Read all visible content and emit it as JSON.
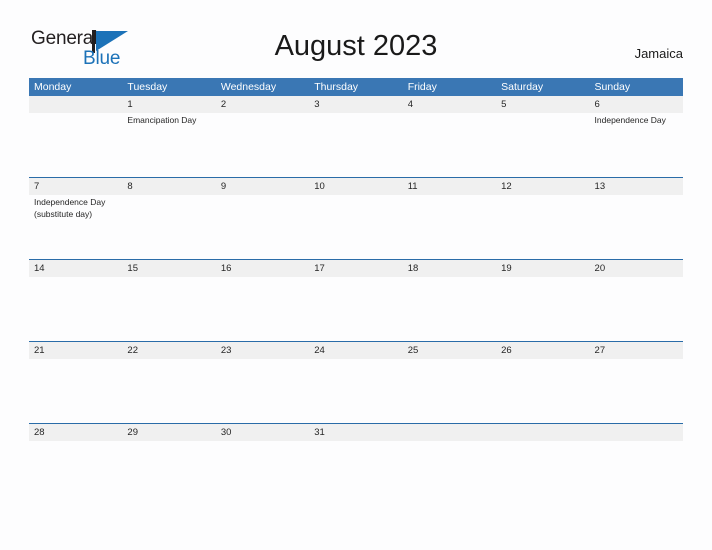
{
  "brand": {
    "name_part1": "General",
    "name_part2": "Blue",
    "flag_color": "#1c72b8",
    "icon": "flag-triangle-icon"
  },
  "header": {
    "title": "August 2023",
    "country": "Jamaica"
  },
  "colors": {
    "header_blue": "#3a77b4",
    "row_rule_blue": "#2a6ca8",
    "band_gray": "#f0f0f0",
    "page_background": "#fdfdfe",
    "text": "#262626"
  },
  "calendar": {
    "weekdays": [
      "Monday",
      "Tuesday",
      "Wednesday",
      "Thursday",
      "Friday",
      "Saturday",
      "Sunday"
    ],
    "weeks": [
      [
        {
          "date": "",
          "events": []
        },
        {
          "date": "1",
          "events": [
            "Emancipation Day"
          ]
        },
        {
          "date": "2",
          "events": []
        },
        {
          "date": "3",
          "events": []
        },
        {
          "date": "4",
          "events": []
        },
        {
          "date": "5",
          "events": []
        },
        {
          "date": "6",
          "events": [
            "Independence Day"
          ]
        }
      ],
      [
        {
          "date": "7",
          "events": [
            "Independence Day",
            "(substitute day)"
          ]
        },
        {
          "date": "8",
          "events": []
        },
        {
          "date": "9",
          "events": []
        },
        {
          "date": "10",
          "events": []
        },
        {
          "date": "11",
          "events": []
        },
        {
          "date": "12",
          "events": []
        },
        {
          "date": "13",
          "events": []
        }
      ],
      [
        {
          "date": "14",
          "events": []
        },
        {
          "date": "15",
          "events": []
        },
        {
          "date": "16",
          "events": []
        },
        {
          "date": "17",
          "events": []
        },
        {
          "date": "18",
          "events": []
        },
        {
          "date": "19",
          "events": []
        },
        {
          "date": "20",
          "events": []
        }
      ],
      [
        {
          "date": "21",
          "events": []
        },
        {
          "date": "22",
          "events": []
        },
        {
          "date": "23",
          "events": []
        },
        {
          "date": "24",
          "events": []
        },
        {
          "date": "25",
          "events": []
        },
        {
          "date": "26",
          "events": []
        },
        {
          "date": "27",
          "events": []
        }
      ],
      [
        {
          "date": "28",
          "events": []
        },
        {
          "date": "29",
          "events": []
        },
        {
          "date": "30",
          "events": []
        },
        {
          "date": "31",
          "events": []
        },
        {
          "date": "",
          "events": []
        },
        {
          "date": "",
          "events": []
        },
        {
          "date": "",
          "events": []
        }
      ]
    ]
  }
}
